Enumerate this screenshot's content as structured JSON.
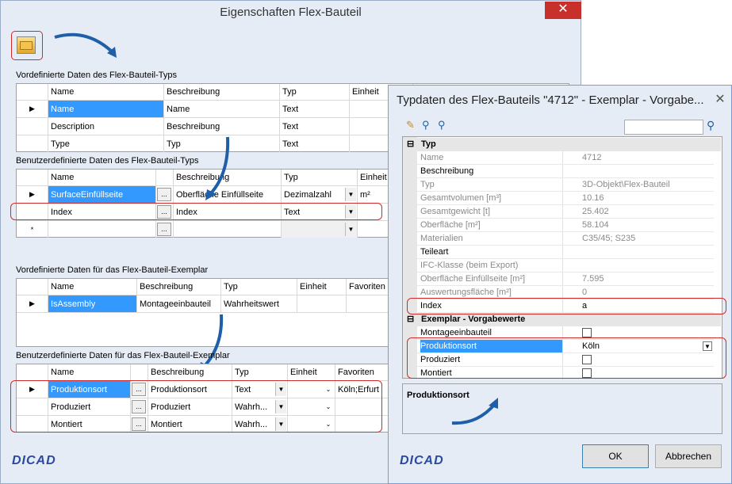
{
  "w1": {
    "title": "Eigenschaften Flex-Bauteil",
    "close": "✕",
    "sec1": "Vordefinierte Daten des Flex-Bauteil-Typs",
    "sec1_headers": [
      "Name",
      "Beschreibung",
      "Typ",
      "Einheit"
    ],
    "sec1_rows": [
      [
        "Name",
        "Name",
        "Text"
      ],
      [
        "Description",
        "Beschreibung",
        "Text"
      ],
      [
        "Type",
        "Typ",
        "Text"
      ]
    ],
    "sec2": "Benutzerdefinierte Daten des Flex-Bauteil-Typs",
    "sec2_headers": [
      "Name",
      "Beschreibung",
      "Typ",
      "Einheit"
    ],
    "sec2_rows": [
      [
        "SurfaceEinfüllseite",
        "Oberfläche Einfüllseite",
        "Dezimalzahl",
        "m²"
      ],
      [
        "Index",
        "Index",
        "Text",
        ""
      ]
    ],
    "sec3": "Vordefinierte Daten für das Flex-Bauteil-Exemplar",
    "sec3_headers": [
      "Name",
      "Beschreibung",
      "Typ",
      "Einheit",
      "Favoriten"
    ],
    "sec3_rows": [
      [
        "IsAssembly",
        "Montageeinbauteil",
        "Wahrheitswert"
      ]
    ],
    "sec4": "Benutzerdefinierte Daten für das Flex-Bauteil-Exemplar",
    "sec4_headers": [
      "Name",
      "Beschreibung",
      "Typ",
      "Einheit",
      "Favoriten"
    ],
    "sec4_rows": [
      [
        "Produktionsort",
        "Produktionsort",
        "Text",
        "Köln;Erfurt"
      ],
      [
        "Produziert",
        "Produziert",
        "Wahrh..."
      ],
      [
        "Montiert",
        "Montiert",
        "Wahrh..."
      ]
    ],
    "ellipsis": "...",
    "newrow": "*",
    "logo": "DICAD"
  },
  "w2": {
    "title": "Typdaten des Flex-Bauteils \"4712\" - Exemplar - Vorgabe...",
    "close": "✕",
    "cat1": "Typ",
    "props": [
      [
        "Name",
        "4712"
      ],
      [
        "Beschreibung",
        ""
      ],
      [
        "Typ",
        "3D-Objekt\\Flex-Bauteil"
      ],
      [
        "Gesamtvolumen [m³]",
        "10.16"
      ],
      [
        "Gesamtgewicht [t]",
        "25.402"
      ],
      [
        "Oberfläche [m²]",
        "58.104"
      ],
      [
        "Materialien",
        "C35/45; S235"
      ],
      [
        "Teileart",
        ""
      ],
      [
        "IFC-Klasse (beim Export)",
        ""
      ],
      [
        "Oberfläche Einfüllseite [m²]",
        "7.595"
      ],
      [
        "Auswertungsfläche [m²]",
        "0"
      ],
      [
        "Index",
        "a"
      ]
    ],
    "cat2": "Exemplar - Vorgabewerte",
    "props2": [
      [
        "Montageeinbauteil"
      ],
      [
        "Produktionsort",
        "Köln"
      ],
      [
        "Produziert"
      ],
      [
        "Montiert"
      ]
    ],
    "desc": "Produktionsort",
    "ok": "OK",
    "cancel": "Abbrechen",
    "logo": "DICAD"
  },
  "colors": {
    "accent": "#3399ff",
    "highlight": "#d02a2a",
    "arrow": "#1f5fa8"
  }
}
